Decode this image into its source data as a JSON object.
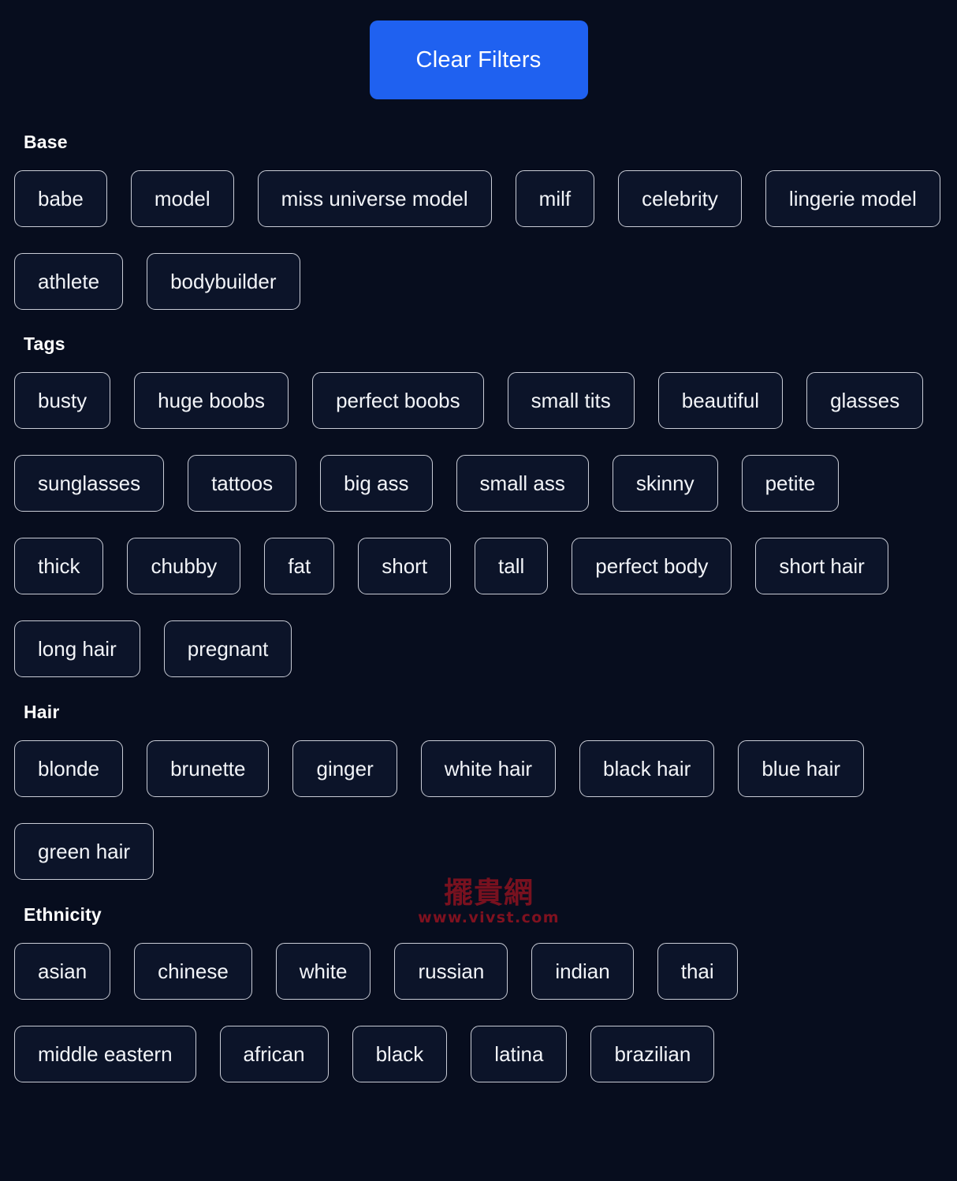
{
  "toolbar": {
    "clear_filters_label": "Clear Filters",
    "accent_color": "#1f61f0"
  },
  "theme": {
    "background": "#070d1e",
    "chip_background": "#0c1429",
    "chip_border": "#c9ccd6",
    "text": "#f2f4f8"
  },
  "sections": [
    {
      "id": "base",
      "title": "Base",
      "chips": [
        "babe",
        "model",
        "miss universe model",
        "milf",
        "celebrity",
        "lingerie model",
        "athlete",
        "bodybuilder"
      ]
    },
    {
      "id": "tags",
      "title": "Tags",
      "chips": [
        "busty",
        "huge boobs",
        "perfect boobs",
        "small tits",
        "beautiful",
        "glasses",
        "sunglasses",
        "tattoos",
        "big ass",
        "small ass",
        "skinny",
        "petite",
        "thick",
        "chubby",
        "fat",
        "short",
        "tall",
        "perfect body",
        "short hair",
        "long hair",
        "pregnant"
      ]
    },
    {
      "id": "hair",
      "title": "Hair",
      "chips": [
        "blonde",
        "brunette",
        "ginger",
        "white hair",
        "black hair",
        "blue hair",
        "green hair"
      ]
    },
    {
      "id": "ethnicity",
      "title": "Ethnicity",
      "chips": [
        "asian",
        "chinese",
        "white",
        "russian",
        "indian",
        "thai",
        "middle eastern",
        "african",
        "black",
        "latina",
        "brazilian"
      ]
    }
  ],
  "watermark": {
    "cjk": "擺貴網",
    "url": "www.vivst.com",
    "color": "#8c1220"
  }
}
